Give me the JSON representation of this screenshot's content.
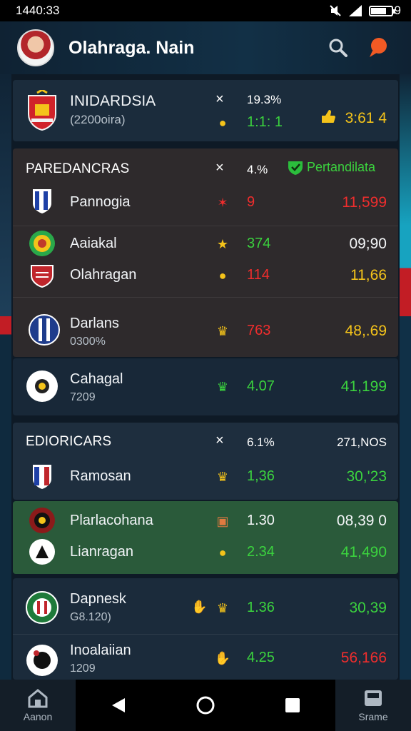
{
  "status_bar": {
    "time": "1440:33",
    "battery": "9"
  },
  "app_bar": {
    "title": "Olahraga. Nain",
    "search_icon": "search-icon",
    "notify_icon": "chat-bubble-icon"
  },
  "top_card": {
    "team": "INIDARDSIA",
    "sub": "(2200oira)",
    "x": "×",
    "pct": "19.3%",
    "val": "1:1: 1",
    "right": "3:61 4"
  },
  "section1": {
    "title": "PAREDANCRAS",
    "x": "×",
    "pct": "4.%",
    "badge": "Pertandilata",
    "rows": [
      {
        "name": "Pannogia",
        "sub": "",
        "mid": "9",
        "right": "11,599",
        "mid_color": "red",
        "right_color": "red"
      },
      {
        "name": "Aaiakal",
        "sub": "",
        "mid": "374",
        "right": "09;90",
        "mid_color": "green",
        "right_color": "white"
      },
      {
        "name": "Olahragan",
        "sub": "",
        "mid": "114",
        "right": "11,66",
        "mid_color": "red",
        "right_color": "yellow"
      },
      {
        "name": "Darlans",
        "sub": "0300%",
        "mid": "763",
        "right": "48,.69",
        "mid_color": "red",
        "right_color": "yellow"
      },
      {
        "name": "Cahagal",
        "sub": "7209",
        "mid": "4.07",
        "right": "41,199",
        "mid_color": "green",
        "right_color": "green"
      }
    ]
  },
  "section2": {
    "title": "EDIORICARS",
    "x": "×",
    "pct": "6.1%",
    "right_head": "271,NOS",
    "rows": [
      {
        "name": "Ramosan",
        "sub": "",
        "mid": "1,36",
        "right": "30,'23",
        "mid_color": "green",
        "right_color": "green"
      },
      {
        "name": "Plarlacohana",
        "sub": "",
        "mid": "1.30",
        "right": "08,39 0",
        "mid_color": "white",
        "right_color": "white"
      },
      {
        "name": "Lianragan",
        "sub": "",
        "mid": "2.34",
        "right": "41,490",
        "mid_color": "green",
        "right_color": "green"
      },
      {
        "name": "Dapnesk",
        "sub": "G8.120)",
        "mid": "1.36",
        "right": "30,39",
        "mid_color": "green",
        "right_color": "green"
      },
      {
        "name": "Inoalaiian",
        "sub": "1209",
        "mid": "4.25",
        "right": "56,166",
        "mid_color": "green",
        "right_color": "red"
      }
    ]
  },
  "nav": {
    "left": "Aanon",
    "right": "Srame"
  },
  "colors": {
    "green": "#3bd33e",
    "red": "#f02d2d",
    "yellow": "#f4c31a",
    "accent": "#f15a24"
  }
}
